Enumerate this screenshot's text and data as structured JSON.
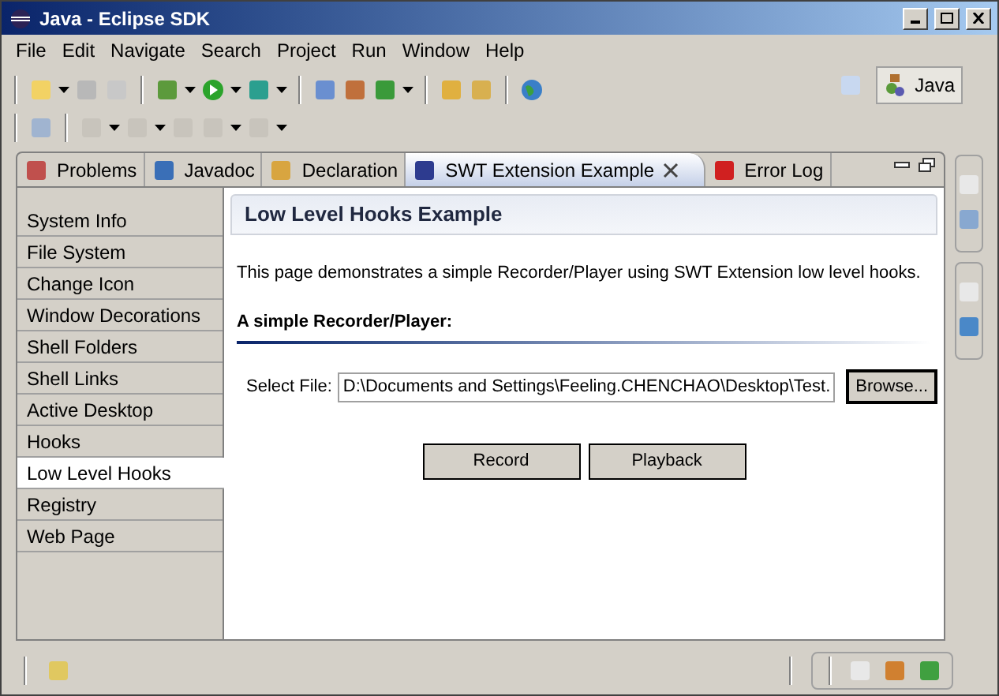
{
  "window": {
    "title": "Java - Eclipse SDK"
  },
  "menu": [
    "File",
    "Edit",
    "Navigate",
    "Search",
    "Project",
    "Run",
    "Window",
    "Help"
  ],
  "perspective": {
    "label": "Java",
    "selected": true
  },
  "tabs": [
    {
      "label": "Problems",
      "selected": false
    },
    {
      "label": "Javadoc",
      "selected": false
    },
    {
      "label": "Declaration",
      "selected": false
    },
    {
      "label": "SWT Extension Example",
      "selected": true
    },
    {
      "label": "Error Log",
      "selected": false
    }
  ],
  "sidebar": {
    "items": [
      {
        "label": "System Info",
        "selected": false
      },
      {
        "label": "File System",
        "selected": false
      },
      {
        "label": "Change Icon",
        "selected": false
      },
      {
        "label": "Window Decorations",
        "selected": false
      },
      {
        "label": "Shell Folders",
        "selected": false
      },
      {
        "label": "Shell Links",
        "selected": false
      },
      {
        "label": "Active Desktop",
        "selected": false
      },
      {
        "label": "Hooks",
        "selected": false
      },
      {
        "label": "Low Level Hooks",
        "selected": true
      },
      {
        "label": "Registry",
        "selected": false
      },
      {
        "label": "Web Page",
        "selected": false
      }
    ]
  },
  "page": {
    "title": "Low Level Hooks Example",
    "description": "This page demonstrates a simple Recorder/Player using SWT Extension low level hooks.",
    "section": "A simple Recorder/Player:",
    "file_label": "Select File:",
    "file_value": "D:\\Documents and Settings\\Feeling.CHENCHAO\\Desktop\\Test.",
    "browse": "Browse...",
    "buttons": [
      "Record",
      "Playback"
    ]
  }
}
